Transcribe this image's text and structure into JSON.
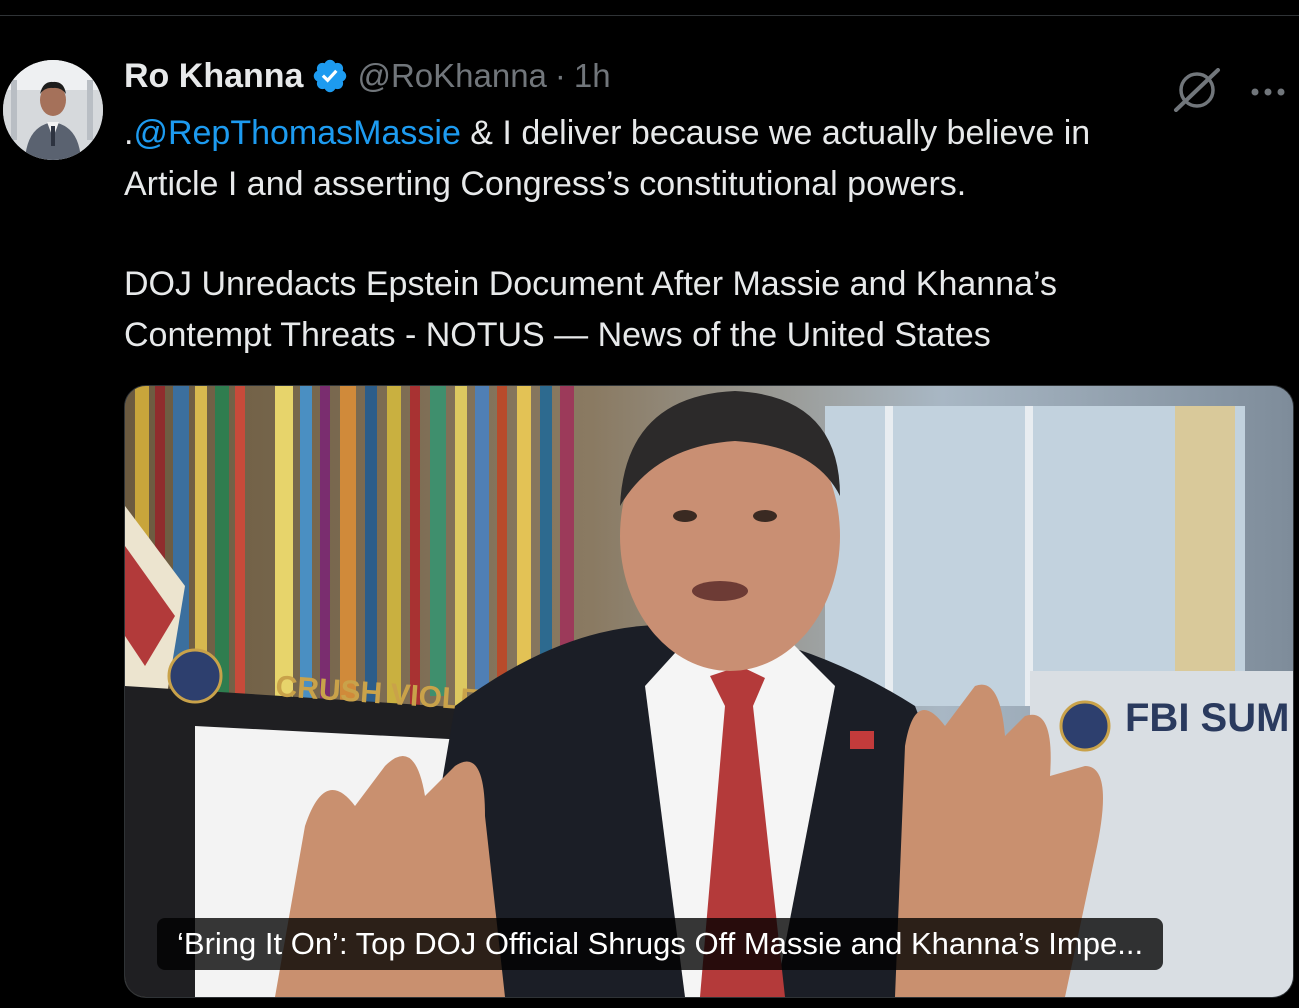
{
  "tweet": {
    "author": {
      "display_name": "Ro Khanna",
      "handle": "@RoKhanna",
      "separator": "·",
      "time": "1h",
      "verified": true,
      "badge_color": "#1d9bf0"
    },
    "text": {
      "prefix": ".",
      "mention": "@RepThomasMassie",
      "line1_rest": " & I deliver because we actually believe in",
      "line2": "Article I and asserting Congress’s constitutional powers.",
      "paragraph2_line1": "DOJ Unredacts Epstein Document After Massie and Khanna’s",
      "paragraph2_line2": "Contempt Threats - NOTUS — News of the United States"
    },
    "card": {
      "caption": "‘Bring It On’: Top DOJ Official Shrugs Off Massie and Khanna’s Impe...",
      "sign_left_text": "CRUSH VIOLENT C",
      "sign_right_text": "FBI SUM"
    },
    "icons": {
      "verified": "verified-badge-icon",
      "grok": "grok-icon",
      "more": "more-options-icon"
    },
    "colors": {
      "background": "#000000",
      "text": "#e7e9ea",
      "secondary": "#71767b",
      "link": "#1d9bf0"
    }
  }
}
